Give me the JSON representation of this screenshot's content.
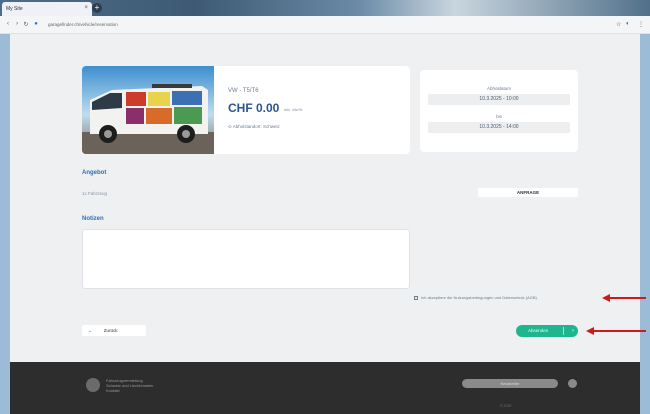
{
  "browser": {
    "tab_title": "My Site",
    "url": "garagefinder.ch/vehicle/reservation",
    "close_glyph": "×",
    "new_tab_glyph": "+"
  },
  "vehicle": {
    "name": "VW - T5/T6",
    "price": "CHF 0.00",
    "price_unit": "inkl. MwSt.",
    "location": "Abholstandort: Schweiz"
  },
  "dates": {
    "from_label": "Abholdatum",
    "from_value": "10.3.2025 - 10:00",
    "to_label": "bis",
    "to_value": "10.3.2025 - 14:00"
  },
  "offer": {
    "title": "Angebot",
    "item": "1x Fahrzeug",
    "button": "ANFRAGE"
  },
  "notes": {
    "title": "Notizen",
    "placeholder": ""
  },
  "terms": {
    "label": "Ich akzeptiere die Nutzungsbedingungen und Datenschutz (AGB)"
  },
  "actions": {
    "back": "Zurück",
    "back_arrow": "←",
    "submit": "Absenden",
    "submit_arrow": "›"
  },
  "footer": {
    "text": "Fahrzeugvermietung\nSchweiz und Liechtenstein\nKontakt",
    "pill": "Newsletter",
    "copyright": "© 2025"
  },
  "colors": {
    "accent": "#2a5590",
    "success": "#1fb58f",
    "annotation": "#d01a1a"
  }
}
